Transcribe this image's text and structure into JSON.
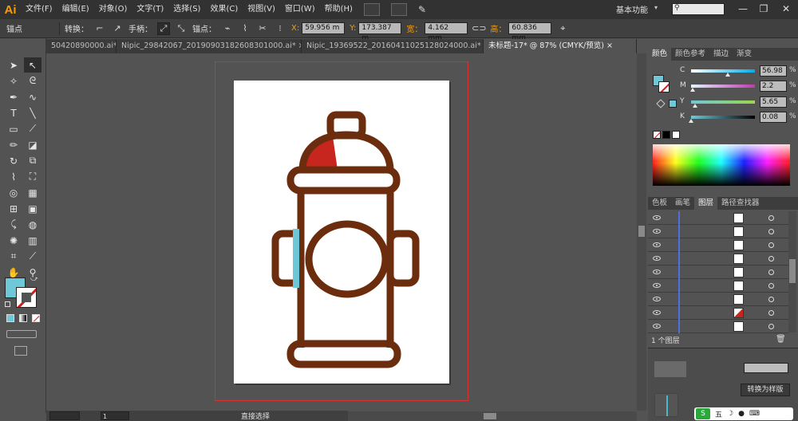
{
  "app": {
    "logo": "Ai",
    "workspace": "基本功能"
  },
  "menu": [
    "文件(F)",
    "编辑(E)",
    "对象(O)",
    "文字(T)",
    "选择(S)",
    "效果(C)",
    "视图(V)",
    "窗口(W)",
    "帮助(H)"
  ],
  "window_buttons": {
    "minimize": "—",
    "restore": "❐",
    "close": "✕"
  },
  "control": {
    "anchor_label": "锚点",
    "convert_label": "转换：",
    "handle_label": "手柄：",
    "anchors_label": "锚点：",
    "x_label": "X:",
    "x_value": "59.956 m",
    "y_label": "Y:",
    "y_value": "173.387 m",
    "w_label": "宽：",
    "w_value": "4.162 mm",
    "h_label": "高：",
    "h_value": "60.836 mm"
  },
  "tabs": [
    {
      "label": "50420890000.ai*",
      "active": false
    },
    {
      "label": "Nipic_29842067_20190903182608301000.ai*",
      "active": false
    },
    {
      "label": "Nipic_19369522_20160411025128024000.ai*",
      "active": false
    },
    {
      "label": "未标题-17* @ 87% (CMYK/预览)",
      "active": true
    }
  ],
  "tab_close": "×",
  "status": {
    "tool": "直接选择",
    "zoom": "",
    "page": "1"
  },
  "colors": {
    "hydrant_outline": "#6b2d0d",
    "cap_red": "#c7261e",
    "accent_blue": "#6ec7d7",
    "fill_swatch": "#6fc8d8"
  },
  "panels": {
    "color_tabs": [
      "颜色",
      "颜色参考",
      "描边",
      "渐变"
    ],
    "cmyk": [
      {
        "label": "C",
        "value": "56.98",
        "pct": 56.98
      },
      {
        "label": "M",
        "value": "2.2",
        "pct": 2.2
      },
      {
        "label": "Y",
        "value": "5.65",
        "pct": 5.65
      },
      {
        "label": "K",
        "value": "0.08",
        "pct": 0.08
      }
    ],
    "layer_tabs": [
      "色板",
      "画笔",
      "图层",
      "路径查找器"
    ],
    "layer_footer": "1 个图层",
    "bottom_button": "转换为样版"
  }
}
